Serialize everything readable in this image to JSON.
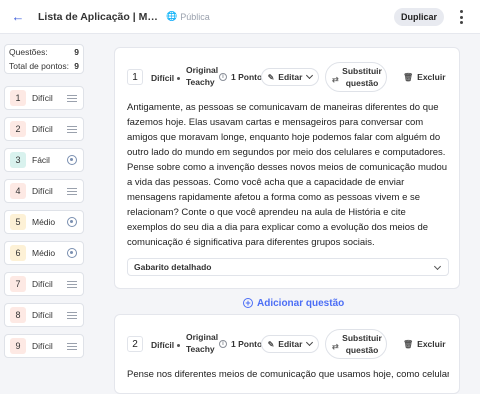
{
  "header": {
    "back_icon": "arrow-left-icon",
    "title": "Lista de Aplicação | Meios e...",
    "visibility_icon": "globe-icon",
    "visibility": "Pública",
    "duplicate_label": "Duplicar",
    "more_icon": "kebab-menu-icon"
  },
  "sidebar": {
    "stats": {
      "questions_label": "Questões:",
      "questions_value": "9",
      "points_label": "Total de pontos:",
      "points_value": "9"
    },
    "items": [
      {
        "num": "1",
        "difficulty": "Difícil",
        "icon": "lines-icon",
        "color": "#fde9e4"
      },
      {
        "num": "2",
        "difficulty": "Difícil",
        "icon": "lines-icon",
        "color": "#fde9e4"
      },
      {
        "num": "3",
        "difficulty": "Fácil",
        "icon": "radio-icon",
        "color": "#d9f2ee"
      },
      {
        "num": "4",
        "difficulty": "Difícil",
        "icon": "lines-icon",
        "color": "#fde9e4"
      },
      {
        "num": "5",
        "difficulty": "Médio",
        "icon": "radio-icon",
        "color": "#fdf1d6"
      },
      {
        "num": "6",
        "difficulty": "Médio",
        "icon": "radio-icon",
        "color": "#fdf1d6"
      },
      {
        "num": "7",
        "difficulty": "Difícil",
        "icon": "lines-icon",
        "color": "#fde9e4"
      },
      {
        "num": "8",
        "difficulty": "Difícil",
        "icon": "lines-icon",
        "color": "#fde9e4"
      },
      {
        "num": "9",
        "difficulty": "Difícil",
        "icon": "lines-icon",
        "color": "#fde9e4"
      }
    ]
  },
  "cards": [
    {
      "num": "1",
      "difficulty": "Difícil",
      "origin": "Original Teachy",
      "points": "1 Ponto",
      "edit": "Editar",
      "substitute": "Substituir questão",
      "delete": "Excluir",
      "text": "Antigamente, as pessoas se comunicavam de maneiras diferentes do que fazemos hoje. Elas usavam cartas e mensageiros para conversar com amigos que moravam longe, enquanto hoje podemos falar com alguém do outro lado do mundo em segundos por meio dos celulares e computadores. Pense sobre como a invenção desses novos meios de comunicação mudou a vida das pessoas. Como você acha que a capacidade de enviar mensagens rapidamente afetou a forma como as pessoas vivem e se relacionam? Conte o que você aprendeu na aula de História e cite exemplos do seu dia a dia para explicar como a evolução dos meios de comunicação é significativa para diferentes grupos sociais.",
      "answer_key": "Gabarito detalhado"
    },
    {
      "num": "2",
      "difficulty": "Difícil",
      "origin": "Original Teachy",
      "points": "1 Ponto",
      "edit": "Editar",
      "substitute": "Substituir questão",
      "delete": "Excluir",
      "text": "Pense nos diferentes meios de comunicação que usamos hoje, como celulares,"
    }
  ],
  "add_question": "Adicionar questão"
}
